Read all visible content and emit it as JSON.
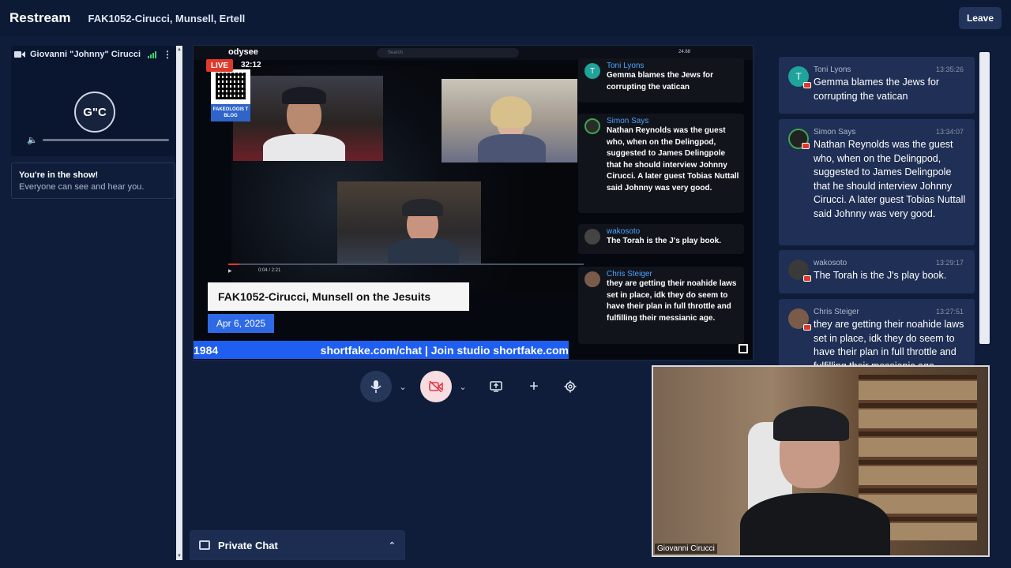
{
  "app": {
    "brand": "Restream",
    "show_title": "FAK1052-Cirucci, Munsell, Ertell",
    "leave_label": "Leave"
  },
  "left_panel": {
    "participant_name": "Giovanni \"Johnny\" Cirucci",
    "avatar_initials": "G\"C",
    "in_show_title": "You're in the show!",
    "in_show_sub": "Everyone can see and hear you."
  },
  "stage": {
    "platform_logo": "odysee",
    "search_placeholder": "Search",
    "view_count": "24.68",
    "live_label": "LIVE",
    "live_time": "32:12",
    "qr_caption": "FAKEOLOGIS T BLOG",
    "player_time": "0:04 / 2:21",
    "title": "FAK1052-Cirucci, Munsell on the Jesuits",
    "date": "Apr 6, 2025",
    "ticker_left": "1984",
    "ticker_right": "shortfake.com/chat | Join studio shortfake.com"
  },
  "overlay_chat": [
    {
      "name": "Toni Lyons",
      "text": "Gemma blames the Jews for corrupting the vatican",
      "avatar": "T",
      "color": "#1fa39a"
    },
    {
      "name": "Simon Says",
      "text": "Nathan Reynolds was the guest who, when on the Delingpod, suggested to James Delingpole that he should interview Johnny Cirucci. A later guest Tobias Nuttall said Johnny was very good.",
      "avatar": "",
      "color": "#2b2b2b"
    },
    {
      "name": "wakosoto",
      "text": "The Torah is the J's play book.",
      "avatar": "",
      "color": "#2b2b2b"
    },
    {
      "name": "Chris Steiger",
      "text": "they are getting their noahide laws set in place, idk they do seem to have their plan in full throttle and fulfilling their messianic age.",
      "avatar": "",
      "color": "#7a5b4a"
    }
  ],
  "controls": {
    "mic": "microphone-icon",
    "camera": "camera-off-icon",
    "share": "screen-share-icon",
    "add": "plus-icon",
    "settings": "gear-icon"
  },
  "private_chat": {
    "label": "Private Chat"
  },
  "right_chat": [
    {
      "name": "Toni Lyons",
      "time": "13:35:26",
      "text": "Gemma blames the Jews for corrupting the vatican",
      "avatar": "T",
      "color": "#1fa39a"
    },
    {
      "name": "Simon Says",
      "time": "13:34:07",
      "text": "Nathan Reynolds was the guest who, when on the Delingpod, suggested to James Delingpole that he should interview Johnny Cirucci. A later guest Tobias Nuttall said Johnny was very good.",
      "avatar": "",
      "color": "#222"
    },
    {
      "name": "wakosoto",
      "time": "13:29:17",
      "text": "The Torah is the J's play book.",
      "avatar": "",
      "color": "#333"
    },
    {
      "name": "Chris Steiger",
      "time": "13:27:51",
      "text": "they are getting their noahide laws set in place, idk they do seem to have their plan in full throttle and fulfilling their messianic age.",
      "avatar": "",
      "color": "#7a5b4a"
    }
  ],
  "self_view": {
    "name_label": "Giovanni Cirucci"
  }
}
